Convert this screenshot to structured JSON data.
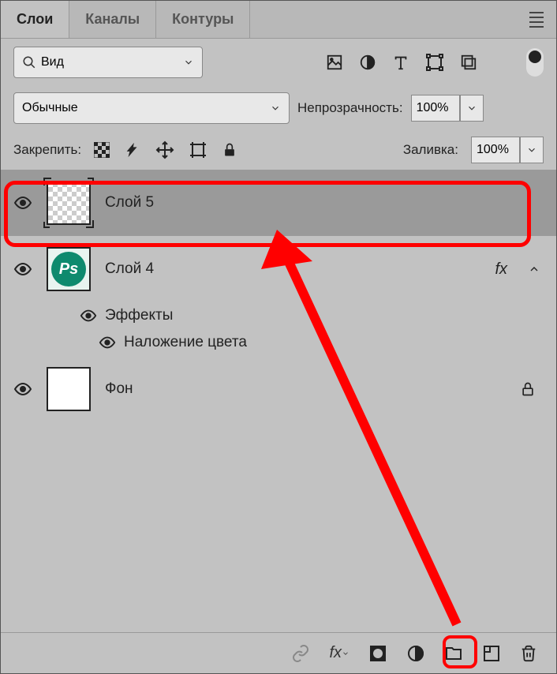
{
  "tabs": {
    "layers": "Слои",
    "channels": "Каналы",
    "paths": "Контуры"
  },
  "kind_label": "Вид",
  "blend_mode": "Обычные",
  "opacity": {
    "label": "Непрозрачность:",
    "value": "100%"
  },
  "lock": {
    "label": "Закрепить:"
  },
  "fill": {
    "label": "Заливка:",
    "value": "100%"
  },
  "layers": [
    {
      "name": "Слой 5"
    },
    {
      "name": "Слой 4",
      "fx": "fx",
      "effects_label": "Эффекты",
      "effects": [
        "Наложение цвета"
      ]
    },
    {
      "name": "Фон"
    }
  ],
  "ps_logo": "Ps"
}
